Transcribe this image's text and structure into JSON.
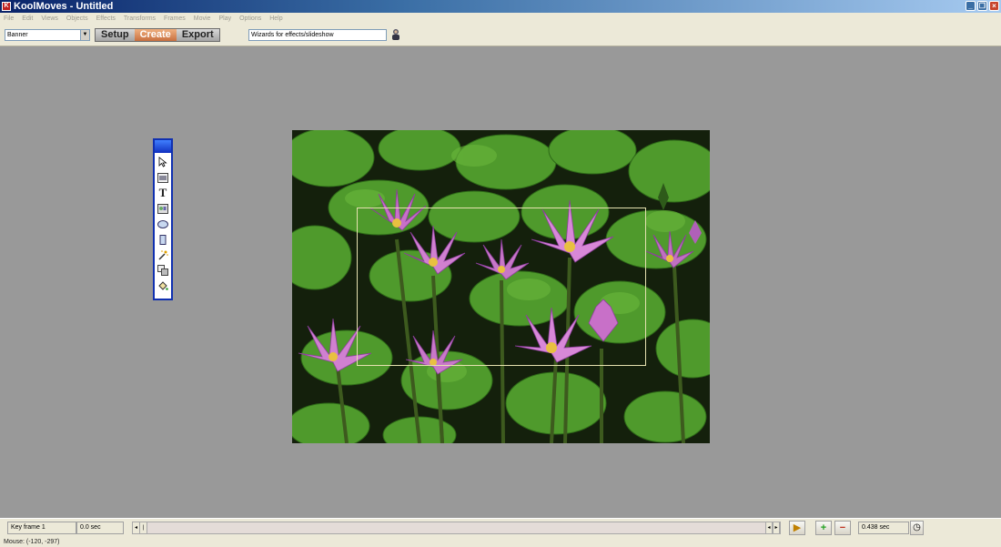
{
  "window": {
    "title": "KoolMoves - Untitled",
    "controls": [
      "minimize-icon",
      "restore-icon",
      "close-icon"
    ]
  },
  "menubar": {
    "items": [
      "File",
      "Edit",
      "Views",
      "Objects",
      "Effects",
      "Transforms",
      "Frames",
      "Movie",
      "Play",
      "Options",
      "Help"
    ]
  },
  "toolbar": {
    "template_select": "Banner",
    "modes": [
      "Setup",
      "Create",
      "Export"
    ],
    "active_mode": "Create",
    "wizard_field": "Wizards for effects/slideshow"
  },
  "tools_palette": {
    "tools": [
      "select-arrow-icon",
      "image-tool-icon",
      "text-tool-icon",
      "library-tool-icon",
      "ellipse-tool-icon",
      "rectangle-tool-icon",
      "effects-wand-icon",
      "transform-tool-icon",
      "fill-bucket-icon"
    ]
  },
  "timeline": {
    "key_frame": "Key frame 1",
    "time": "0.0 sec",
    "duration": "0.438 sec"
  },
  "status": {
    "mouse": "Mouse: (-120, -297)"
  }
}
